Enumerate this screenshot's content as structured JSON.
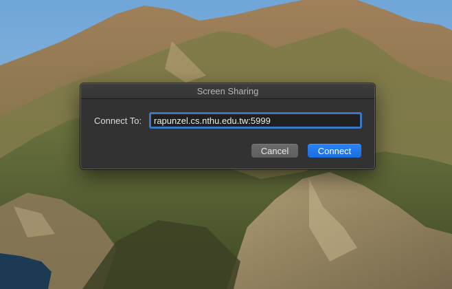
{
  "dialog": {
    "title": "Screen Sharing",
    "connect_label": "Connect To:",
    "address_value": "rapunzel.cs.nthu.edu.tw:5999",
    "cancel_label": "Cancel",
    "connect_button_label": "Connect"
  },
  "colors": {
    "accent": "#1a6ee0",
    "focus_ring": "#3b78c4",
    "dialog_bg": "#323232"
  }
}
